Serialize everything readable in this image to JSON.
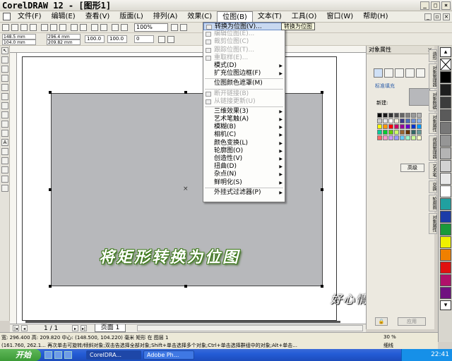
{
  "window": {
    "title": "CorelDRAW 12 - [图形1]",
    "min": "_",
    "max": "□",
    "close": "×"
  },
  "menu": [
    {
      "label": "文件(F)"
    },
    {
      "label": "编辑(E)"
    },
    {
      "label": "查看(V)"
    },
    {
      "label": "版面(L)"
    },
    {
      "label": "排列(A)"
    },
    {
      "label": "效果(C)"
    },
    {
      "label": "位图(B)"
    },
    {
      "label": "文本(T)"
    },
    {
      "label": "工具(O)"
    },
    {
      "label": "窗口(W)"
    },
    {
      "label": "帮助(H)"
    }
  ],
  "toolbar": {
    "zoom": "100%"
  },
  "property_bar": {
    "x": "148.5 mm",
    "y": "104.0 mm",
    "w": "296.4 mm",
    "h": "209.82 mm",
    "scale_w": "100.0",
    "scale_h": "100.0",
    "angle": "0"
  },
  "bitmap_menu": {
    "items": [
      {
        "label": "转换为位图(V)...",
        "state": "highlight",
        "sub": false
      },
      {
        "label": "编辑位图(E)...",
        "state": "disabled",
        "sub": false
      },
      {
        "label": "裁剪位图(C)",
        "state": "disabled",
        "sub": false
      },
      {
        "label": "跟踪位图(T)...",
        "state": "disabled",
        "sub": false
      },
      {
        "label": "重取样(E)...",
        "state": "disabled",
        "sub": false
      },
      {
        "label": "模式(D)",
        "state": "normal",
        "sub": true
      },
      {
        "label": "扩充位图边框(F)",
        "state": "normal",
        "sub": true
      },
      {
        "sep": true
      },
      {
        "label": "位图颜色遮罩(M)",
        "state": "normal",
        "sub": false
      },
      {
        "sep": true
      },
      {
        "label": "断开链接(B)",
        "state": "disabled",
        "sub": false
      },
      {
        "label": "从链接更新(U)",
        "state": "disabled",
        "sub": false
      },
      {
        "sep": true
      },
      {
        "label": "三维效果(3)",
        "state": "normal",
        "sub": true
      },
      {
        "label": "艺术笔触(A)",
        "state": "normal",
        "sub": true
      },
      {
        "label": "模糊(B)",
        "state": "normal",
        "sub": true
      },
      {
        "label": "相机(C)",
        "state": "normal",
        "sub": true
      },
      {
        "label": "颜色变换(L)",
        "state": "normal",
        "sub": true
      },
      {
        "label": "轮廓图(O)",
        "state": "normal",
        "sub": true
      },
      {
        "label": "创造性(V)",
        "state": "normal",
        "sub": true
      },
      {
        "label": "扭曲(D)",
        "state": "normal",
        "sub": true
      },
      {
        "label": "杂点(N)",
        "state": "normal",
        "sub": true
      },
      {
        "label": "鲜明化(S)",
        "state": "normal",
        "sub": true
      },
      {
        "sep": true
      },
      {
        "label": "外挂式过滤器(P)",
        "state": "normal",
        "sub": true
      }
    ],
    "tooltip": "转换为位图"
  },
  "canvas": {
    "banner": "将矩形转换为位图",
    "signature": "好心情",
    "rect_color": "#b7b8bb",
    "center_mark": "×"
  },
  "docker": {
    "title": "对象属性",
    "close": "×",
    "std_fill": "标准填充",
    "new_label": "新建:",
    "advanced": "高级",
    "apply": "应用",
    "lock": "🔒",
    "tabs": [
      "造形",
      "对象管理器",
      "对象数据",
      "对象属性",
      "视图管理器",
      "艺术笔",
      "变换",
      "轮廓图",
      "对象属性"
    ],
    "swatches": [
      "#000000",
      "#1a1a1a",
      "#333333",
      "#4d4d4d",
      "#666666",
      "#808080",
      "#999999",
      "#b3b3b3",
      "#cccccc",
      "#e6e6e6",
      "#ffffff",
      "#f5f0dc",
      "#3a3a8c",
      "#4b6cb7",
      "#6e8fd6",
      "#8fb3e6",
      "#ffff00",
      "#ff9900",
      "#ff0000",
      "#cc0066",
      "#990099",
      "#6600cc",
      "#0033cc",
      "#0099ff",
      "#00cc99",
      "#00cc33",
      "#66cc00",
      "#ccff66",
      "#996633",
      "#663300",
      "#336666",
      "#669999",
      "#ff6666",
      "#ff99cc",
      "#cc99ff",
      "#9999ff",
      "#66ccff",
      "#99ffcc",
      "#ccff99",
      "#ffffcc"
    ]
  },
  "palette": {
    "colors": [
      "#000000",
      "#1e1e1e",
      "#3c3c3c",
      "#5a5a5a",
      "#787878",
      "#969696",
      "#b4b4b4",
      "#d2d2d2",
      "#e8e8e8",
      "#ffffff",
      "#20a0a0",
      "#1c3ca8",
      "#1a9a3a",
      "#f0f000",
      "#f08000",
      "#e01010",
      "#b0106a",
      "#701080"
    ]
  },
  "pages": {
    "pager": "1 / 1",
    "tab": "页面 1"
  },
  "status": {
    "line1": "宽: 296.400 高: 209.820 中心: (148.500, 104.220) 毫米          矩形 在 图层 1",
    "line2": "(161.760, 262.1...    再次单击可旋转/倾斜对象;双击告选择全部对象;Shift+单击选择多个对象;Ctrl+单击选择群组中的对象;Alt+单击...",
    "fill": "30 %",
    "outline": "细线"
  },
  "taskbar": {
    "start": "开始",
    "tasks": [
      {
        "label": "CorelDRA..."
      },
      {
        "label": "Adobe Ph..."
      }
    ],
    "clock": "22:41"
  }
}
